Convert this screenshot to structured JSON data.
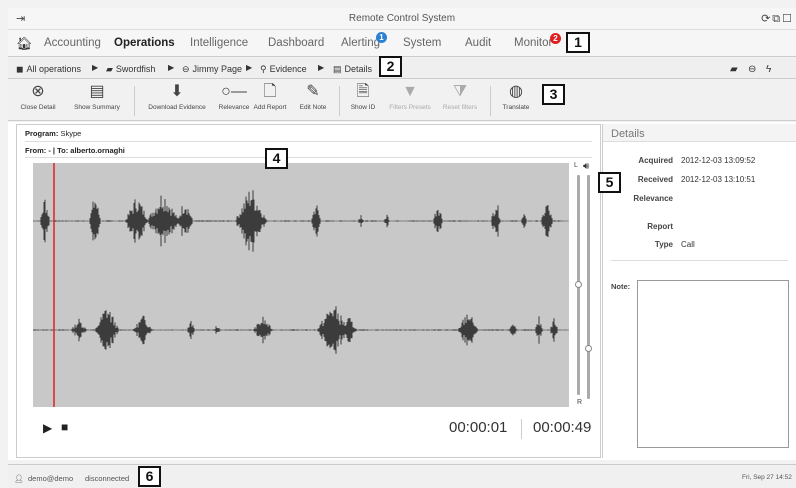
{
  "window": {
    "title": "Remote Control System",
    "controls": "⟳⧉☐"
  },
  "menu": {
    "items": [
      {
        "label": "Accounting"
      },
      {
        "label": "Operations"
      },
      {
        "label": "Intelligence"
      },
      {
        "label": "Dashboard"
      },
      {
        "label": "Alerting"
      },
      {
        "label": "System"
      },
      {
        "label": "Audit"
      },
      {
        "label": "Monitor"
      }
    ],
    "alerting_badge": "1",
    "monitor_badge": "2"
  },
  "breadcrumb": {
    "items": [
      {
        "label": "All operations"
      },
      {
        "label": "Swordfish"
      },
      {
        "label": "Jimmy Page"
      },
      {
        "label": "Evidence"
      },
      {
        "label": "Details"
      }
    ]
  },
  "toolbar": {
    "close_detail": "Close Detail",
    "show_summary": "Show Summary",
    "download_evidence": "Download Evidence",
    "relevance": "Relevance",
    "add_report": "Add Report",
    "edit_note": "Edit Note",
    "show_id": "Show ID",
    "filters_presets": "Filters Presets",
    "reset_filters": "Reset filters",
    "translate": "Translate"
  },
  "evidence": {
    "program_label": "Program:",
    "program_value": "Skype",
    "from_to": "From: - | To: alberto.ornaghi",
    "channel_left": "L",
    "channel_right": "R",
    "elapsed": "00:00:01",
    "duration": "00:00:49"
  },
  "details": {
    "header": "Details",
    "acquired_label": "Acquired",
    "acquired_value": "2012-12-03 13:09:52",
    "received_label": "Received",
    "received_value": "2012-12-03 13:10:51",
    "relevance_label": "Relevance",
    "report_label": "Report",
    "type_label": "Type",
    "type_value": "Call",
    "note_label": "Note:"
  },
  "status": {
    "user": "demo@demo",
    "connection": "disconnected",
    "datetime": "Fri, Sep 27  14:52"
  },
  "callouts": [
    "1",
    "2",
    "3",
    "4",
    "5",
    "6"
  ],
  "colors": {
    "waveform_bg": "#c8c8c8",
    "playhead": "#e02020",
    "badge_blue": "#2d7fd3",
    "badge_red": "#e02020"
  }
}
